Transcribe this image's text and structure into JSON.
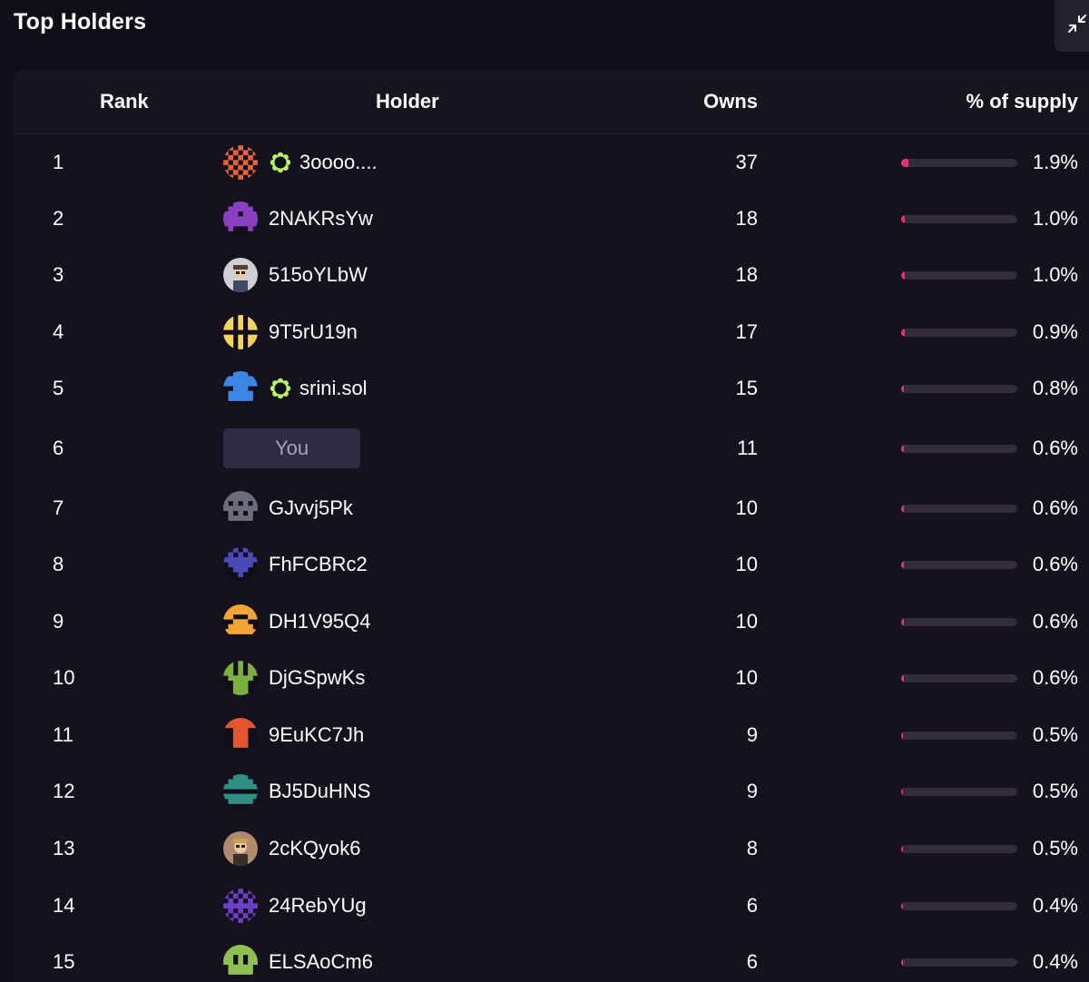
{
  "title": "Top Holders",
  "accent_color": "#e0356f",
  "columns": {
    "rank": "Rank",
    "holder": "Holder",
    "owns": "Owns",
    "pct": "% of supply"
  },
  "rows": [
    {
      "rank": "1",
      "holder": "3oooo....",
      "verified": true,
      "avatar": "orange-pixel",
      "owns": "37",
      "pct": "1.9%",
      "pct_value": 1.9
    },
    {
      "rank": "2",
      "holder": "2NAKRsYw",
      "verified": false,
      "avatar": "purple-pixel",
      "owns": "18",
      "pct": "1.0%",
      "pct_value": 1.0
    },
    {
      "rank": "3",
      "holder": "515oYLbW",
      "verified": false,
      "avatar": "photo-character",
      "owns": "18",
      "pct": "1.0%",
      "pct_value": 1.0
    },
    {
      "rank": "4",
      "holder": "9T5rU19n",
      "verified": false,
      "avatar": "yellow-pixel",
      "owns": "17",
      "pct": "0.9%",
      "pct_value": 0.9
    },
    {
      "rank": "5",
      "holder": "srini.sol",
      "verified": true,
      "avatar": "blue-pixel",
      "owns": "15",
      "pct": "0.8%",
      "pct_value": 0.8
    },
    {
      "rank": "6",
      "holder": "You",
      "is_you": true,
      "owns": "11",
      "pct": "0.6%",
      "pct_value": 0.6
    },
    {
      "rank": "7",
      "holder": "GJvvj5Pk",
      "verified": false,
      "avatar": "gray-pixel",
      "owns": "10",
      "pct": "0.6%",
      "pct_value": 0.6
    },
    {
      "rank": "8",
      "holder": "FhFCBRc2",
      "verified": false,
      "avatar": "indigo-pixel",
      "owns": "10",
      "pct": "0.6%",
      "pct_value": 0.6
    },
    {
      "rank": "9",
      "holder": "DH1V95Q4",
      "verified": false,
      "avatar": "amber-pixel",
      "owns": "10",
      "pct": "0.6%",
      "pct_value": 0.6
    },
    {
      "rank": "10",
      "holder": "DjGSpwKs",
      "verified": false,
      "avatar": "green-pixel",
      "owns": "10",
      "pct": "0.6%",
      "pct_value": 0.6
    },
    {
      "rank": "11",
      "holder": "9EuKC7Jh",
      "verified": false,
      "avatar": "red-orange-pixel",
      "owns": "9",
      "pct": "0.5%",
      "pct_value": 0.5
    },
    {
      "rank": "12",
      "holder": "BJ5DuHNS",
      "verified": false,
      "avatar": "teal-pixel",
      "owns": "9",
      "pct": "0.5%",
      "pct_value": 0.5
    },
    {
      "rank": "13",
      "holder": "2cKQyok6",
      "verified": false,
      "avatar": "photo-character-2",
      "owns": "8",
      "pct": "0.5%",
      "pct_value": 0.5
    },
    {
      "rank": "14",
      "holder": "24RebYUg",
      "verified": false,
      "avatar": "violet-pixel",
      "owns": "6",
      "pct": "0.4%",
      "pct_value": 0.4
    },
    {
      "rank": "15",
      "holder": "ELSAoCm6",
      "verified": false,
      "avatar": "lime-pixel",
      "owns": "6",
      "pct": "0.4%",
      "pct_value": 0.4
    }
  ]
}
